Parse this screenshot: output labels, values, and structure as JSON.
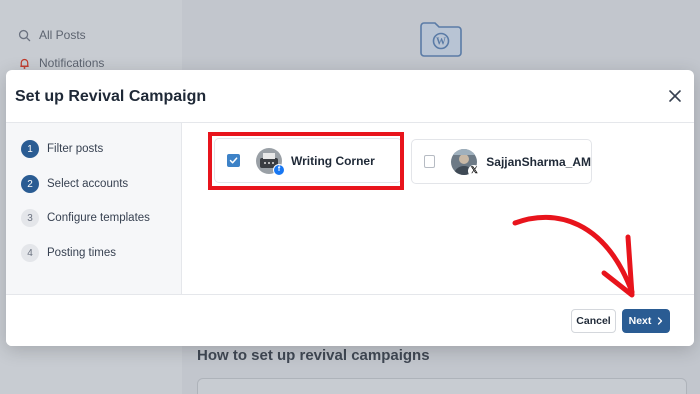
{
  "background": {
    "nav": [
      {
        "label": "All Posts",
        "icon": "search-icon"
      },
      {
        "label": "Notifications",
        "icon": "bell-icon"
      }
    ],
    "section_heading": "How to set up revival campaigns"
  },
  "modal": {
    "title": "Set up Revival Campaign",
    "steps": [
      {
        "number": "1",
        "label": "Filter posts",
        "state": "active"
      },
      {
        "number": "2",
        "label": "Select accounts",
        "state": "active"
      },
      {
        "number": "3",
        "label": "Configure templates",
        "state": "inactive"
      },
      {
        "number": "4",
        "label": "Posting times",
        "state": "inactive"
      }
    ],
    "accounts": [
      {
        "name": "Writing Corner",
        "network": "facebook",
        "checked": true
      },
      {
        "name": "SajjanSharma_AM",
        "network": "x",
        "checked": false
      }
    ],
    "footer": {
      "cancel_label": "Cancel",
      "next_label": "Next"
    }
  },
  "colors": {
    "primary": "#2a5c93",
    "checkbox_checked": "#3d82c7",
    "annotation_red": "#e8141c",
    "overlay": "#c4c8cf"
  }
}
